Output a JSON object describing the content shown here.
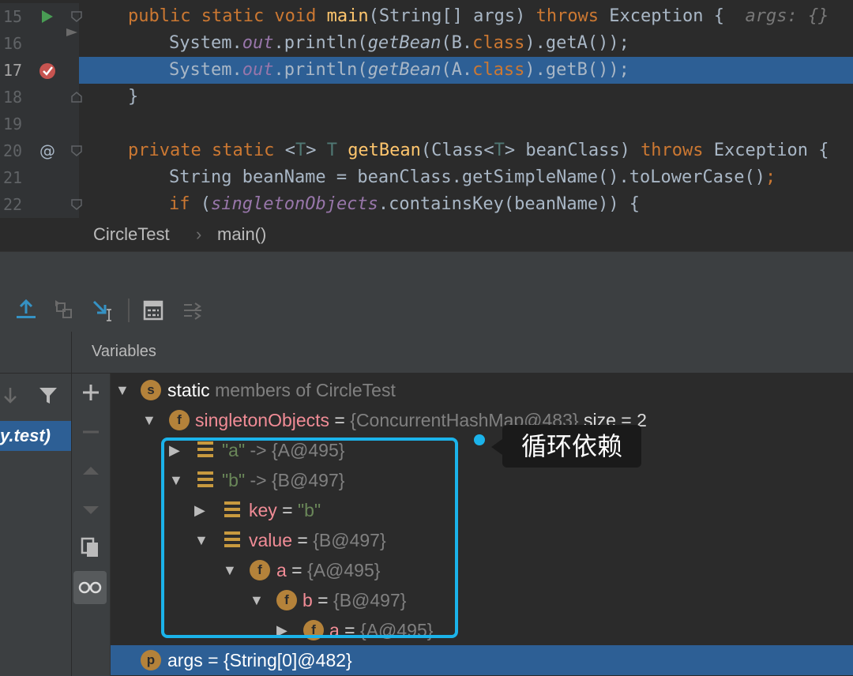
{
  "editor": {
    "lines": [
      {
        "num": "15"
      },
      {
        "num": "16"
      },
      {
        "num": "17"
      },
      {
        "num": "18"
      },
      {
        "num": "19"
      },
      {
        "num": "20"
      },
      {
        "num": "21"
      },
      {
        "num": "22"
      }
    ],
    "code": {
      "l15_kw1": "public static void ",
      "l15_fn": "main",
      "l15_a": "(String[] args) ",
      "l15_kw2": "throws ",
      "l15_b": "Exception {",
      "l15_hint": "args: {}",
      "l16_a": "System.",
      "l16_out": "out",
      "l16_b": ".println(",
      "l16_call": "getBean",
      "l16_c": "(B.",
      "l16_kw": "class",
      "l16_d": ").getA());",
      "l17_a": "System.",
      "l17_out": "out",
      "l17_b": ".println(",
      "l17_call": "getBean",
      "l17_c": "(A.",
      "l17_kw": "class",
      "l17_d": ").getB());",
      "l18": "}",
      "l20_kw1": "private static ",
      "l20_t1": "<",
      "l20_T1": "T",
      "l20_t2": "> ",
      "l20_T2": "T ",
      "l20_fn": "getBean",
      "l20_a": "(Class<",
      "l20_T3": "T",
      "l20_b": "> beanClass) ",
      "l20_kw2": "throws ",
      "l20_c": "Exception {",
      "l21_a": "String beanName = beanClass.getSimpleName().toLowerCase()",
      "l21_semi": ";",
      "l22_kw": "if ",
      "l22_a": "(",
      "l22_field": "singletonObjects",
      "l22_b": ".containsKey(beanName)) {"
    }
  },
  "breadcrumb": {
    "class_name": "CircleTest",
    "sep": "›",
    "method": "main()"
  },
  "debug": {
    "frame_selected": "y.test)",
    "variables_title": "Variables",
    "tree": [
      {
        "id": "static",
        "label": "static",
        "rest": " members of CircleTest"
      },
      {
        "id": "singleton",
        "name": "singletonObjects",
        "eq": " = ",
        "value": "{ConcurrentHashMap@483}",
        "extra": "  size = 2"
      },
      {
        "id": "entry_a",
        "key": "\"a\"",
        "arrow": " -> ",
        "value": "{A@495}"
      },
      {
        "id": "entry_b",
        "key": "\"b\"",
        "arrow": " -> ",
        "value": "{B@497}"
      },
      {
        "id": "key",
        "name": "key",
        "eq": " = ",
        "value": "\"b\""
      },
      {
        "id": "value",
        "name": "value",
        "eq": " = ",
        "value": "{B@497}"
      },
      {
        "id": "fa",
        "name": "a",
        "eq": " = ",
        "value": "{A@495}"
      },
      {
        "id": "fb",
        "name": "b",
        "eq": " = ",
        "value": "{B@497}"
      },
      {
        "id": "fa2",
        "name": "a",
        "eq": " = ",
        "value": "{A@495}"
      },
      {
        "id": "args",
        "name": "args",
        "eq": " = ",
        "value": "{String[0]@482}"
      }
    ],
    "badges": {
      "static": "s",
      "field": "f",
      "param": "p"
    },
    "callout": "循环依赖"
  },
  "colors": {
    "accent": "#2d5f95",
    "callout": "#1bb3ea",
    "background": "#2b2b2b"
  }
}
